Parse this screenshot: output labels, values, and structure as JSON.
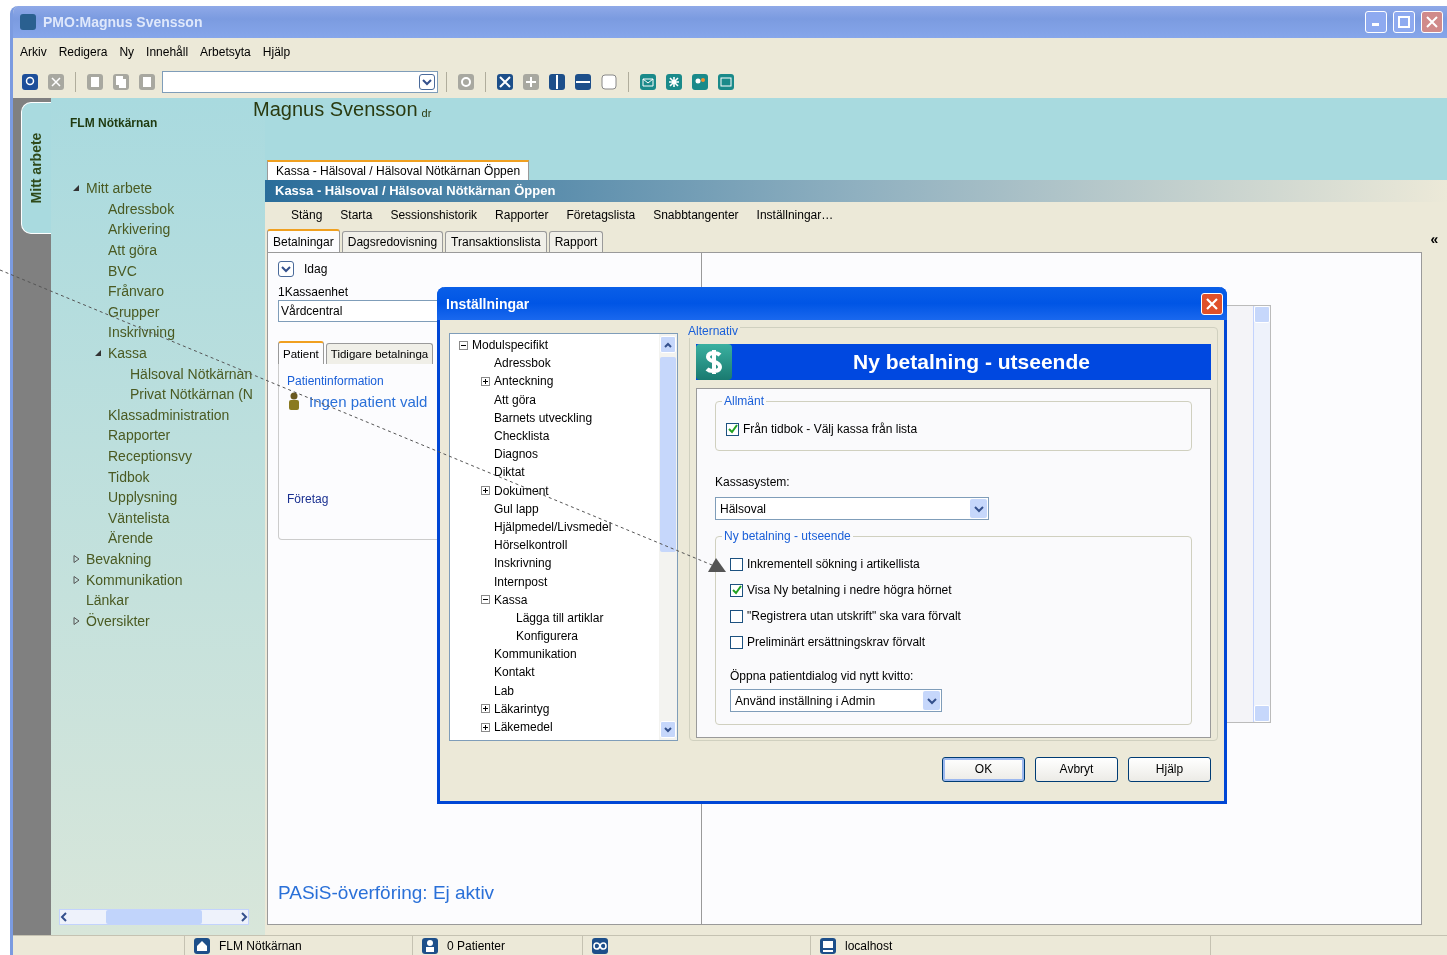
{
  "window": {
    "title": "PMO:Magnus Svensson"
  },
  "menu": [
    "Arkiv",
    "Redigera",
    "Ny",
    "Innehåll",
    "Arbetsyta",
    "Hjälp"
  ],
  "sidebar": {
    "vertical_tab": "Mitt arbete",
    "unit": "FLM Nötkärnan",
    "tree": [
      {
        "label": "Mitt arbete",
        "expanded": true,
        "children": [
          {
            "label": "Adressbok"
          },
          {
            "label": "Arkivering"
          },
          {
            "label": "Att göra"
          },
          {
            "label": "BVC"
          },
          {
            "label": "Frånvaro"
          },
          {
            "label": "Grupper"
          },
          {
            "label": "Inskrivning"
          },
          {
            "label": "Kassa",
            "expanded": true,
            "children": [
              {
                "label": "Hälsoval Nötkärnan"
              },
              {
                "label": "Privat Nötkärnan (N"
              }
            ]
          },
          {
            "label": "Klassadministration"
          },
          {
            "label": "Rapporter"
          },
          {
            "label": "Receptionsvy"
          },
          {
            "label": "Tidbok"
          },
          {
            "label": "Upplysning"
          },
          {
            "label": "Väntelista"
          },
          {
            "label": "Ärende"
          }
        ]
      },
      {
        "label": "Bevakning",
        "expanded": false
      },
      {
        "label": "Kommunikation",
        "expanded": false
      },
      {
        "label": "Länkar"
      },
      {
        "label": "Översikter",
        "expanded": false
      }
    ]
  },
  "header": {
    "name": "Magnus Svensson",
    "suffix": "dr"
  },
  "document": {
    "tab": "Kassa - Hälsoval / Hälsoval Nötkärnan Öppen",
    "title": "Kassa - Hälsoval / Hälsoval Nötkärnan Öppen",
    "commands": [
      "Stäng",
      "Starta",
      "Sessionshistorik",
      "Rapporter",
      "Företagslista",
      "Snabbtangenter",
      "Inställningar…"
    ],
    "tabs": [
      {
        "label": "Betalningar",
        "selected": true
      },
      {
        "label": "Dagsredovisning",
        "selected": false
      },
      {
        "label": "Transaktionslista",
        "selected": false
      },
      {
        "label": "Rapport",
        "selected": false
      }
    ],
    "period": "Idag",
    "unit_label": "1Kassaenhet",
    "unit_value": "Vårdcentral",
    "patient_tabs": [
      {
        "label": "Patient",
        "selected": true
      },
      {
        "label": "Tidigare betalninga",
        "selected": false
      }
    ],
    "patient_group": "Patientinformation",
    "patient": "Ingen patient vald",
    "company": "Företag",
    "pasis": "PASiS-överföring: Ej aktiv",
    "collapse": "«"
  },
  "dialog": {
    "title": "Inställningar",
    "tree": [
      {
        "label": "Modulspecifikt",
        "expanded": true,
        "children": [
          {
            "label": "Adressbok"
          },
          {
            "label": "Anteckning",
            "expanded": false
          },
          {
            "label": "Att göra"
          },
          {
            "label": "Barnets utveckling"
          },
          {
            "label": "Checklista"
          },
          {
            "label": "Diagnos"
          },
          {
            "label": "Diktat"
          },
          {
            "label": "Dokument",
            "expanded": false
          },
          {
            "label": "Gul lapp"
          },
          {
            "label": "Hjälpmedel/Livsmedel"
          },
          {
            "label": "Hörselkontroll"
          },
          {
            "label": "Inskrivning"
          },
          {
            "label": "Internpost"
          },
          {
            "label": "Kassa",
            "expanded": true,
            "children": [
              {
                "label": "Lägga till artiklar"
              },
              {
                "label": "Konfigurera"
              }
            ]
          },
          {
            "label": "Kommunikation"
          },
          {
            "label": "Kontakt"
          },
          {
            "label": "Lab"
          },
          {
            "label": "Läkarintyg",
            "expanded": false
          },
          {
            "label": "Läkemedel",
            "expanded": false
          }
        ]
      }
    ],
    "section": "Alternativ",
    "banner": "Ny betalning - utseende",
    "general": {
      "legend": "Allmänt",
      "options": [
        {
          "label": "Från tidbok - Välj kassa från lista",
          "checked": true
        }
      ]
    },
    "cash_system": {
      "label": "Kassasystem:",
      "value": "Hälsoval"
    },
    "appearance": {
      "legend": "Ny betalning - utseende",
      "options": [
        {
          "label": "Inkrementell sökning i artikellista",
          "checked": false
        },
        {
          "label": "Visa Ny betalning i nedre högra hörnet",
          "checked": true
        },
        {
          "label": "\"Registrera utan utskrift\" ska vara förvalt",
          "checked": false
        },
        {
          "label": "Preliminärt ersättningskrav förvalt",
          "checked": false
        }
      ],
      "dialog_label": "Öppna patientdialog vid nytt kvitto:",
      "dialog_value": "Använd inställning i Admin"
    },
    "buttons": [
      "OK",
      "Avbryt",
      "Hjälp"
    ]
  },
  "status_bar": [
    {
      "kind": "home",
      "label": "FLM Nötkärnan"
    },
    {
      "kind": "person",
      "label": "0 Patienter"
    },
    {
      "kind": "loop"
    },
    {
      "kind": "computer",
      "label": "localhost"
    }
  ]
}
